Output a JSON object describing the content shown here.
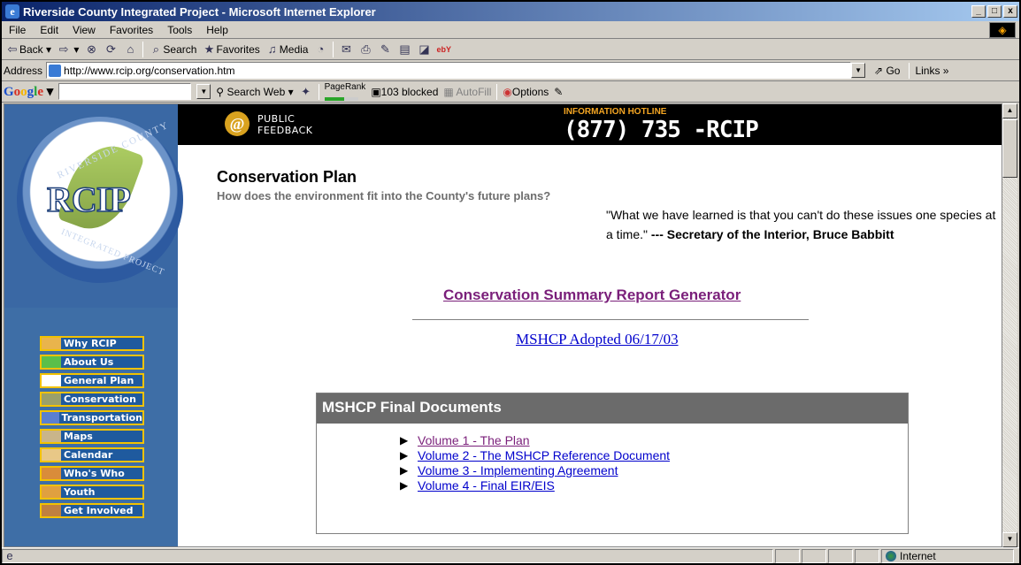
{
  "window": {
    "title": "Riverside County Integrated Project - Microsoft Internet Explorer",
    "min": "_",
    "max": "□",
    "close": "x"
  },
  "menu": [
    "File",
    "Edit",
    "View",
    "Favorites",
    "Tools",
    "Help"
  ],
  "toolbar": {
    "back": "Back",
    "search": "Search",
    "favorites": "Favorites",
    "media": "Media"
  },
  "address": {
    "label": "Address",
    "url": "http://www.rcip.org/conservation.htm",
    "go": "Go",
    "links": "Links »"
  },
  "google": {
    "logo": [
      "G",
      "o",
      "o",
      "g",
      "l",
      "e"
    ],
    "search_web": "Search Web",
    "pagerank": "PageRank",
    "blocked": "103 blocked",
    "autofill": "AutoFill",
    "options": "Options"
  },
  "site": {
    "logo_text": "RCIP",
    "logo_ring_top": "RIVERSIDE COUNTY",
    "logo_ring_bottom": "INTEGRATED PROJECT",
    "feedback_line1": "PUBLIC",
    "feedback_line2": "FEEDBACK",
    "hotline_label": "INFORMATION HOTLINE",
    "hotline_number": "(877) 735 -RCIP"
  },
  "nav": [
    {
      "label": "Why RCIP"
    },
    {
      "label": "About Us"
    },
    {
      "label": "General Plan"
    },
    {
      "label": "Conservation"
    },
    {
      "label": "Transportation"
    },
    {
      "label": "Maps"
    },
    {
      "label": "Calendar"
    },
    {
      "label": "Who's Who"
    },
    {
      "label": "Youth"
    },
    {
      "label": "Get Involved"
    }
  ],
  "content": {
    "title": "Conservation Plan",
    "subtitle": "How does the environment fit into the County's future plans?",
    "quote_text": "\"What we have learned is that you can't do these issues one species at a time.\"",
    "quote_author": "--- Secretary of the Interior, Bruce Babbitt",
    "summary_link": "Conservation Summary Report Generator",
    "adopted_link": "MSHCP Adopted 06/17/03",
    "docs_title": "MSHCP Final Documents",
    "docs": [
      "Volume 1 - The Plan",
      "Volume 2 - The MSHCP Reference Document",
      "Volume 3 - Implementing Agreement",
      "Volume 4 - Final EIR/EIS"
    ]
  },
  "status": {
    "zone": "Internet"
  }
}
